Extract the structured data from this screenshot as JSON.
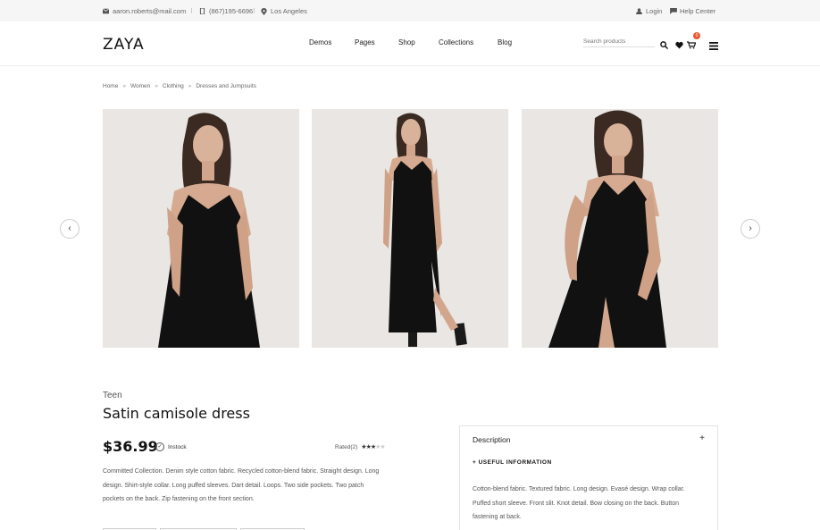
{
  "topbar": {
    "email": "aaron.roberts@mail.com",
    "phone": "(867)195-6696",
    "location": "Los Angeles",
    "login": "Login",
    "help": "Help Center"
  },
  "header": {
    "logo": "ZAYA",
    "nav": [
      "Demos",
      "Pages",
      "Shop",
      "Collections",
      "Blog"
    ],
    "search_placeholder": "Search products",
    "cart_count": "0"
  },
  "breadcrumb": [
    "Home",
    "Women",
    "Clothing",
    "Dresses and Jumpsuits"
  ],
  "gallery": {
    "prev_icon": "‹",
    "next_icon": "›"
  },
  "product": {
    "category": "Teen",
    "title": "Satin camisole dress",
    "price": "$36.99",
    "stock": "Instock",
    "rated": "Rated(2)",
    "rating": 3,
    "rating_max": 5,
    "description": "Committed Collection. Denim style cotton fabric. Recycled cotton-blend fabric. Straight design. Long design. Shirt-style collar. Long puffed sleeves. Dart detail. Loops. Two side pockets. Two patch pockets on the back. Zip fastening on the front section."
  },
  "panel": {
    "heading": "Description",
    "toggle": "+",
    "subheading": "+ USEFUL INFORMATION",
    "text": "Cotton-blend fabric. Textured fabric. Long design. Evasé design. Wrap collar. Puffed short sleeve. Front slit. Knot detail. Bow closing on the back. Button fastening at back."
  },
  "colors": {
    "accent": "#e8572f",
    "photo_bg": "#e9e6e3",
    "dress": "#111111"
  }
}
